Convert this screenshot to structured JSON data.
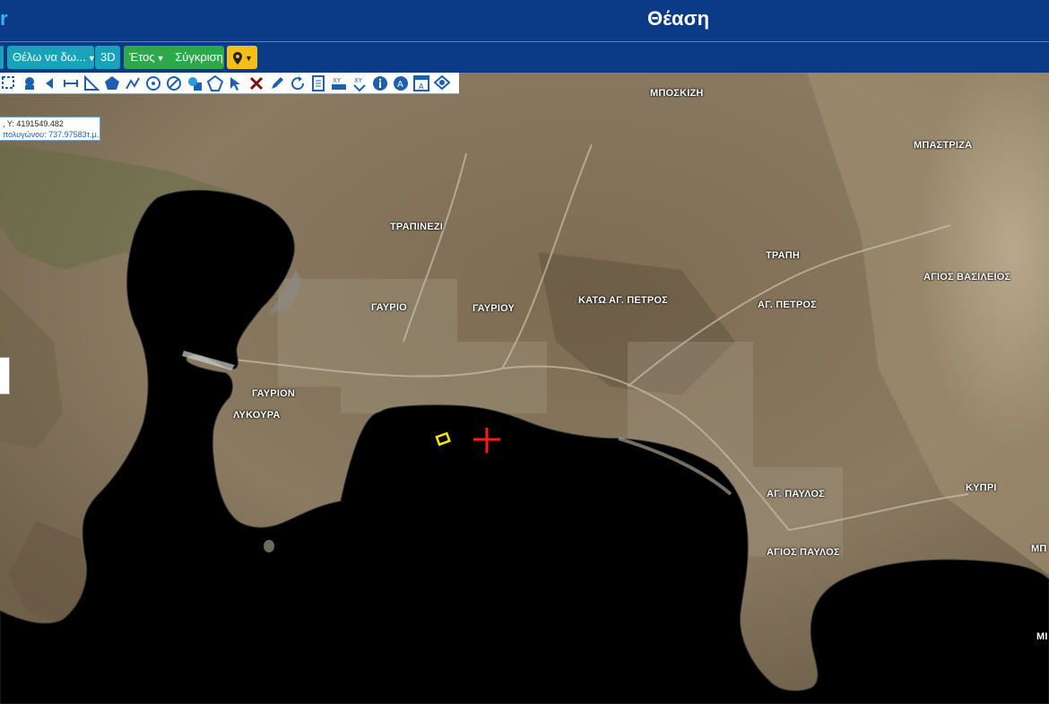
{
  "header": {
    "logo_text": "r",
    "title": "Θέαση"
  },
  "navbar": {
    "want_to_see": "Θέλω να δω...",
    "three_d": "3D",
    "year": "Έτος",
    "compare": "Σύγκριση",
    "location_icon": "map-marker-icon"
  },
  "toolbar": {
    "icons": [
      "zoom-box-icon",
      "pan-hand-icon",
      "back-arrow-icon",
      "measure-distance-icon",
      "measure-angle-icon",
      "polygon-icon",
      "polyline-icon",
      "circle-icon",
      "eraser-icon",
      "shape-select-icon",
      "geometry-icon",
      "select-cursor-icon",
      "delete-cross-icon",
      "edit-pen-icon",
      "refresh-icon",
      "document-icon",
      "xy-coordinates-icon",
      "xy-transform-icon",
      "info-icon",
      "info-text-icon",
      "print-layout-icon",
      "search-map-icon"
    ]
  },
  "coordinates": {
    "line1": ", Y: 4191549.482",
    "line2": "πολυγώνου: 737.97583τ.μ."
  },
  "map": {
    "colors": {
      "sea": "#000000",
      "land": "#8a7a62",
      "parcel": "#ffe600",
      "marker": "#ff1a1a"
    },
    "labels": [
      {
        "key": "mposkizi",
        "text": "ΜΠΟΣΚΙΖΗ"
      },
      {
        "key": "mpastriza",
        "text": "ΜΠΑΣΤΡΙΖΑ"
      },
      {
        "key": "trapinezi",
        "text": "ΤΡΑΠΙΝΕΖΙ"
      },
      {
        "key": "trapi",
        "text": "ΤΡΑΠΗ"
      },
      {
        "key": "agios_vasileios",
        "text": "ΑΓΙΟΣ ΒΑΣΙΛΕΙΟΣ"
      },
      {
        "key": "gavrio1",
        "text": "ΓΑΥΡΙΟ"
      },
      {
        "key": "gavriou",
        "text": "ΓΑΥΡΙΟΥ"
      },
      {
        "key": "kato_petros",
        "text": "ΚΑΤΩ ΑΓ. ΠΕΤΡΟΣ"
      },
      {
        "key": "ag_petros",
        "text": "ΑΓ. ΠΕΤΡΟΣ"
      },
      {
        "key": "gavrion",
        "text": "ΓΑΥΡΙΟΝ"
      },
      {
        "key": "lykoura",
        "text": "ΛΥΚΟΥΡΑ"
      },
      {
        "key": "ag_pavlos",
        "text": "ΑΓ. ΠΑΥΛΟΣ"
      },
      {
        "key": "kypri",
        "text": "ΚΥΠΡΙ"
      },
      {
        "key": "agios_pavlos",
        "text": "ΑΓΙΟΣ ΠΑΥΛΟΣ"
      },
      {
        "key": "mp_cut",
        "text": "ΜΠ"
      },
      {
        "key": "mi_cut",
        "text": "ΜΙ"
      }
    ]
  }
}
